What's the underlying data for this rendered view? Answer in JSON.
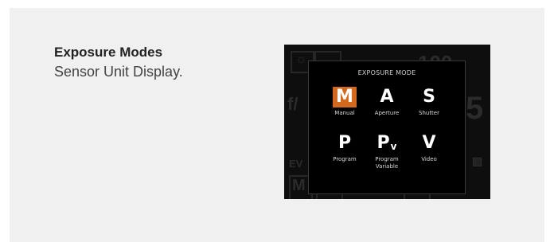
{
  "caption": {
    "title": "Exposure Modes",
    "subtitle": "Sensor Unit Display."
  },
  "background_display": {
    "iso_value": "100",
    "aperture_prefix": "f/",
    "shutter_digit": "5",
    "ev_label": "EV",
    "mode_letter": "M"
  },
  "dialog": {
    "title": "EXPOSURE MODE",
    "accent_color": "#d2691e",
    "modes": [
      {
        "glyph": "M",
        "label": "Manual",
        "active": true
      },
      {
        "glyph": "A",
        "label": "Aperture",
        "active": false
      },
      {
        "glyph": "S",
        "label": "Shutter",
        "active": false
      },
      {
        "glyph": "P",
        "label": "Program",
        "active": false
      },
      {
        "glyph": "P",
        "glyph_sub": "v",
        "label": "Program Variable",
        "active": false
      },
      {
        "glyph": "V",
        "label": "Video",
        "active": false
      }
    ]
  }
}
